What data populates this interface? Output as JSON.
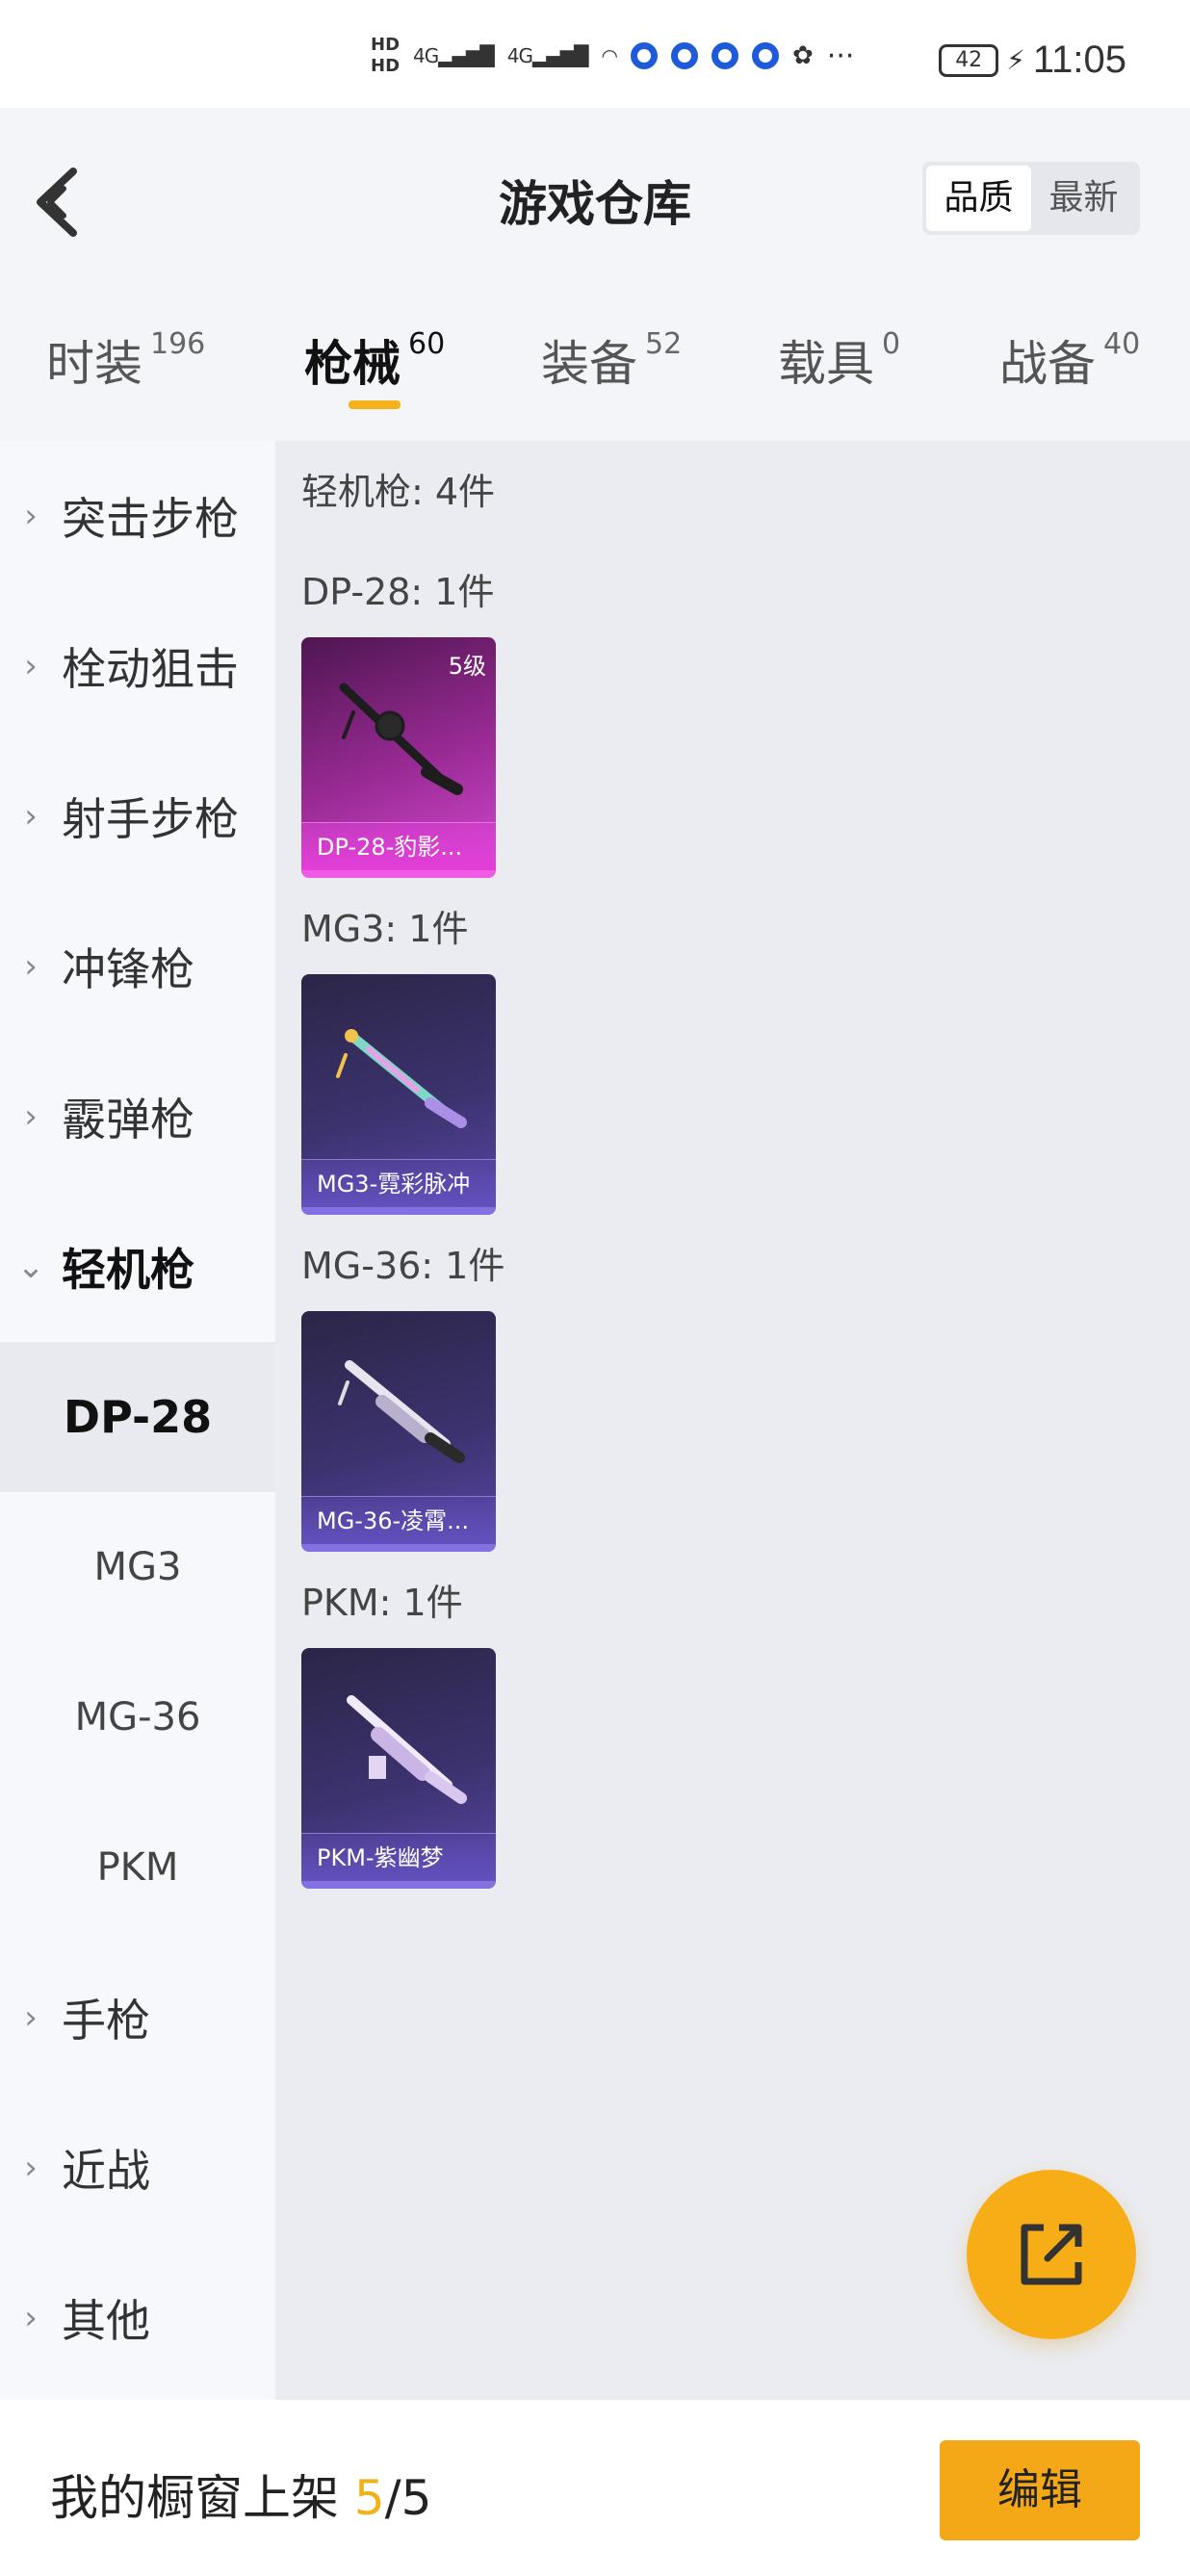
{
  "status_bar": {
    "hd1": "HD",
    "hd2": "HD",
    "signal1": "4G",
    "signal2": "4G",
    "battery": "42",
    "time": "11:05"
  },
  "header": {
    "title": "游戏仓库",
    "sort_options": [
      "品质",
      "最新"
    ],
    "sort_selected": "品质"
  },
  "tabs": [
    {
      "label": "时装",
      "count": "196"
    },
    {
      "label": "枪械",
      "count": "60"
    },
    {
      "label": "装备",
      "count": "52"
    },
    {
      "label": "载具",
      "count": "0"
    },
    {
      "label": "战备",
      "count": "40"
    }
  ],
  "active_tab": "枪械",
  "sidebar": {
    "categories_top": [
      "突击步枪",
      "栓动狙击",
      "射手步枪",
      "冲锋枪",
      "霰弹枪"
    ],
    "expanded_category": "轻机枪",
    "sub_items": [
      "DP-28",
      "MG3",
      "MG-36",
      "PKM"
    ],
    "selected_sub_item": "DP-28",
    "categories_bottom": [
      "手枪",
      "近战",
      "其他"
    ]
  },
  "content": {
    "section_title": "轻机枪: 4件",
    "groups": [
      {
        "title": "DP-28: 1件",
        "item_name": "DP-28-豹影...",
        "level": "5级",
        "rarity_color": "#d44ad0"
      },
      {
        "title": "MG3: 1件",
        "item_name": "MG3-霓彩脉冲",
        "level": "",
        "rarity_color": "#6250bd"
      },
      {
        "title": "MG-36: 1件",
        "item_name": "MG-36-凌霄...",
        "level": "",
        "rarity_color": "#6250bd"
      },
      {
        "title": "PKM: 1件",
        "item_name": "PKM-紫幽梦",
        "level": "",
        "rarity_color": "#6250bd"
      }
    ]
  },
  "bottom_bar": {
    "showcase_label": "我的橱窗上架",
    "showcase_current": "5",
    "showcase_total": "/5",
    "edit_label": "编辑"
  },
  "colors": {
    "accent": "#f5a817",
    "tab_indicator": "#f4b31c"
  },
  "icons": {
    "back": "back-arrow-icon",
    "share": "share-external-icon",
    "chevron": "chevron-right-icon"
  }
}
